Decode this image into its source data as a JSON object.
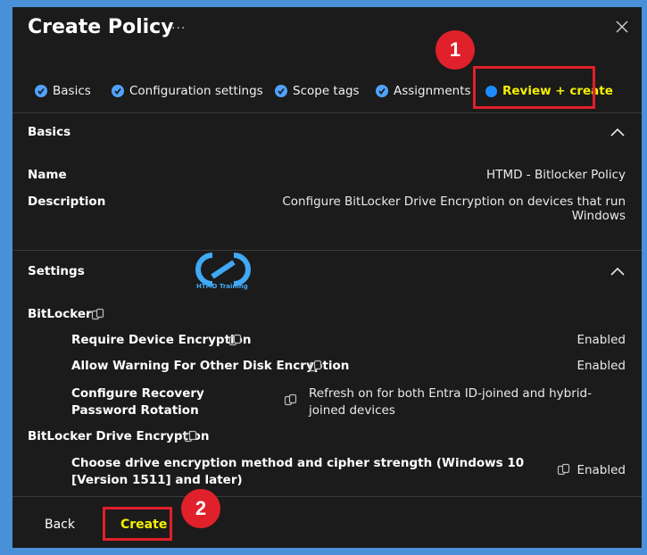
{
  "header": {
    "title": "Create Policy",
    "more_label": "···"
  },
  "tabs": [
    {
      "label": "Basics",
      "state": "complete"
    },
    {
      "label": "Configuration settings",
      "state": "complete"
    },
    {
      "label": "Scope tags",
      "state": "complete"
    },
    {
      "label": "Assignments",
      "state": "complete"
    },
    {
      "label": "Review + create",
      "state": "active"
    }
  ],
  "annotations": {
    "marker_1": "1",
    "marker_2": "2"
  },
  "basics": {
    "heading": "Basics",
    "name_label": "Name",
    "name_value": "HTMD - Bitlocker Policy",
    "description_label": "Description",
    "description_value": "Configure BitLocker Drive Encryption on devices that run Windows"
  },
  "watermark": {
    "text": "HTMD Training"
  },
  "settings": {
    "heading": "Settings",
    "groups": [
      {
        "name": "BitLocker",
        "items": [
          {
            "name": "Require Device Encryption",
            "value": "Enabled"
          },
          {
            "name": "Allow Warning For Other Disk Encryption",
            "value": "Enabled"
          },
          {
            "name": "Configure Recovery Password Rotation",
            "value": "Refresh on for both Entra ID-joined and hybrid-joined devices"
          }
        ]
      },
      {
        "name": "BitLocker Drive Encryption",
        "items": [
          {
            "name": "Choose drive encryption method and cipher strength (Windows 10 [Version 1511] and later)",
            "value": "Enabled"
          }
        ]
      }
    ]
  },
  "footer": {
    "back_label": "Back",
    "create_label": "Create"
  },
  "colors": {
    "accent": "#4fa3ff",
    "highlight": "#e0202b",
    "active_tab": "#f5f000",
    "background": "#1b1b1b"
  }
}
